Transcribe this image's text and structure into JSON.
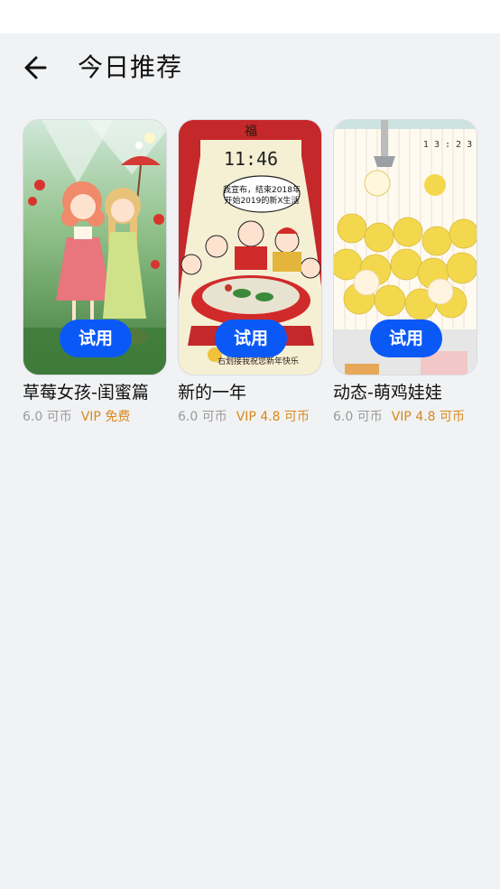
{
  "header": {
    "back_icon": "arrow-left-icon",
    "title": "今日推荐"
  },
  "colors": {
    "accent": "#0a59f7",
    "vip": "#d6891a",
    "muted": "#9a9a9a",
    "background": "#f1f2f4"
  },
  "cards": [
    {
      "name": "草莓女孩-闺蜜篇",
      "price": "6.0 可币",
      "vip_price": "VIP 免费",
      "button": "试用"
    },
    {
      "name": "新的一年",
      "price": "6.0 可币",
      "vip_price": "VIP 4.8 可币",
      "button": "试用",
      "preview_text": {
        "clock": "11:46",
        "speech": [
          "我宣布，结束2018年",
          "开始2019的新X生活"
        ],
        "footer": "右划接我祝您新年快乐"
      }
    },
    {
      "name": "动态-萌鸡娃娃",
      "price": "6.0 可币",
      "vip_price": "VIP 4.8 可币",
      "button": "试用",
      "preview_text": {
        "clock": "1 3 : 2 3"
      }
    }
  ]
}
